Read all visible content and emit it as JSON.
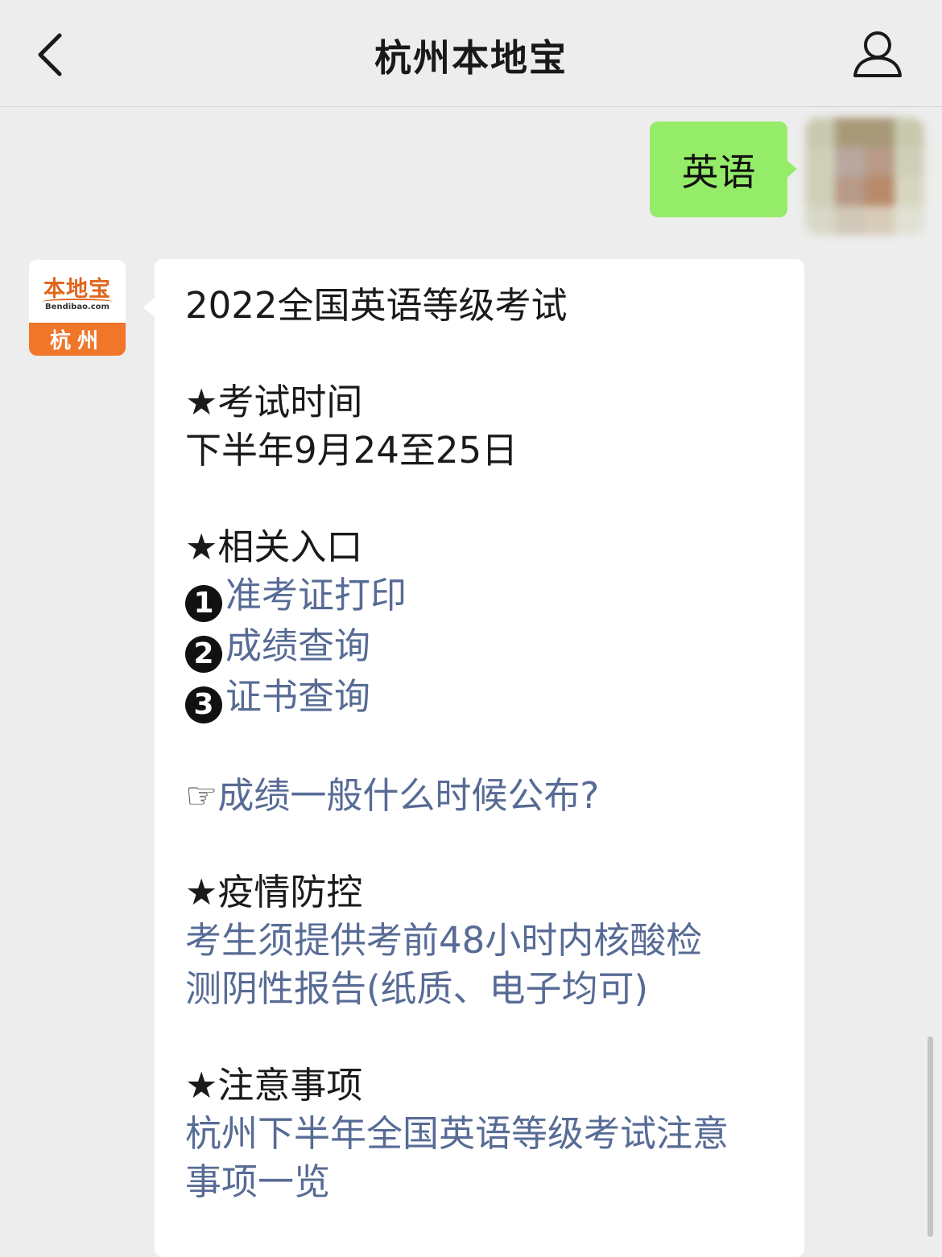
{
  "header": {
    "title": "杭州本地宝",
    "back_icon": "chevron-left-icon",
    "profile_icon": "person-icon"
  },
  "sent_message": {
    "text": "英语"
  },
  "bot": {
    "avatar_brand": "本地宝",
    "avatar_url": "Bendibao.com",
    "avatar_city": "杭州"
  },
  "reply": {
    "title": "2022全国英语等级考试",
    "exam_time_heading": "★考试时间",
    "exam_time_value": "下半年9月24至25日",
    "entries_heading": "★相关入口",
    "entries": [
      {
        "num": "1",
        "label": "准考证打印"
      },
      {
        "num": "2",
        "label": "成绩查询"
      },
      {
        "num": "3",
        "label": "证书查询"
      }
    ],
    "score_release_prefix": "☞",
    "score_release_link": "成绩一般什么时候公布?",
    "epidemic_heading": "★疫情防控",
    "epidemic_line1": "考生须提供考前48小时内核酸检",
    "epidemic_line2": "测阴性报告(纸质、电子均可)",
    "notes_heading": "★注意事项",
    "notes_line1": "杭州下半年全国英语等级考试注意",
    "notes_line2": "事项一览"
  },
  "colors": {
    "background": "#ededed",
    "sent_bubble": "#95ec69",
    "link": "#576b95",
    "brand_orange": "#f0762a"
  }
}
